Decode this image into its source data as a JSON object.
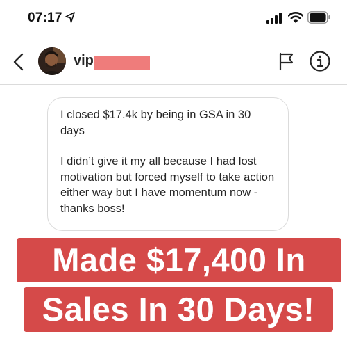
{
  "status_bar": {
    "time": "07:17",
    "icons": [
      "location-arrow-icon",
      "cellular-signal-icon",
      "wifi-icon",
      "battery-icon"
    ]
  },
  "header": {
    "back_icon": "chevron-left-icon",
    "username_visible": "vip",
    "username_redacted": true,
    "actions": [
      "flag-icon",
      "info-icon"
    ]
  },
  "message": {
    "paragraphs": [
      "I closed $17.4k by being in GSA in 30 days",
      "I didn’t give it my all because I had lost motivation but forced myself to take action either way but I have momentum now - thanks boss!"
    ]
  },
  "overlay": {
    "line1": "Made $17,400 In",
    "line2": "Sales In 30 Days!"
  },
  "colors": {
    "caption_background": "#d54a49",
    "caption_text": "#ffffff",
    "redaction": "#ef7c7b",
    "bubble_border": "#dbdbdb",
    "text": "#262626"
  }
}
